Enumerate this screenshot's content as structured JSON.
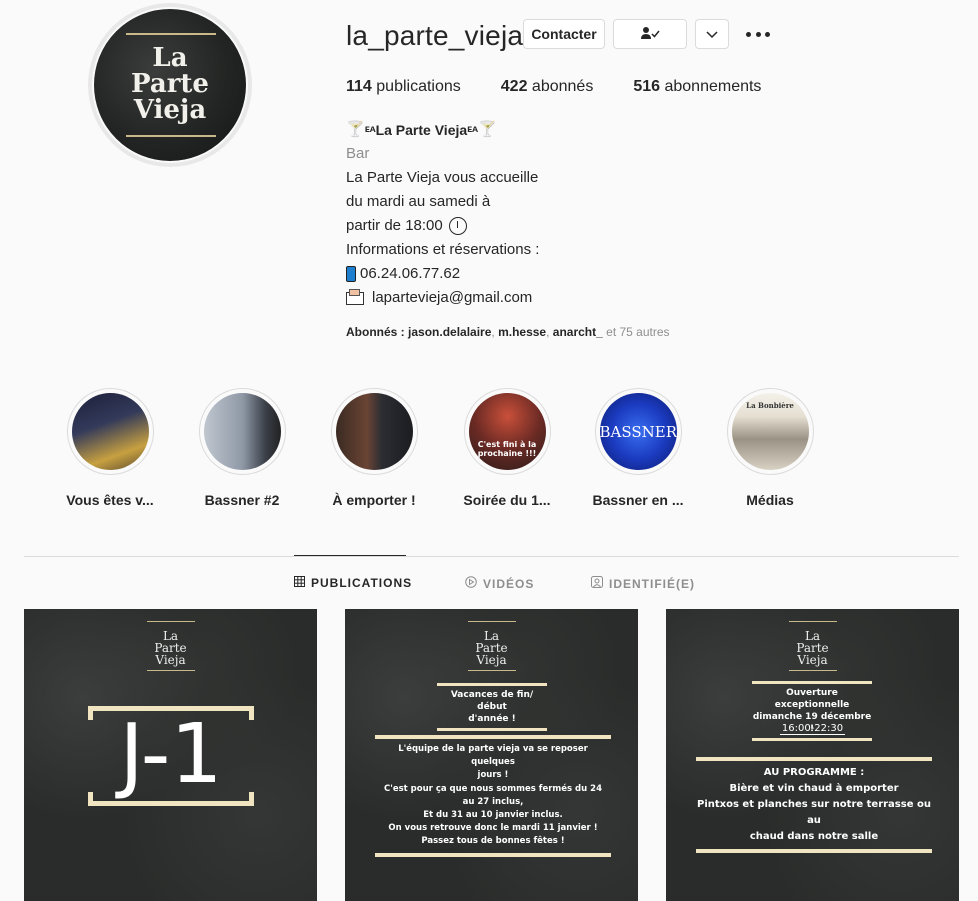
{
  "profile": {
    "avatar_text": [
      "La",
      "Parte",
      "Vieja"
    ],
    "username": "la_parte_vieja",
    "contact_label": "Contacter",
    "follow_icon": "person-check-icon",
    "chevron_icon": "chevron-down-icon",
    "more_icon": "ellipsis-icon"
  },
  "stats": [
    {
      "value": "114",
      "label": "publications"
    },
    {
      "value": "422",
      "label": "abonnés"
    },
    {
      "value": "516",
      "label": "abonnements"
    }
  ],
  "bio": {
    "name_prefix": "🍸",
    "name_tag_left": "ᴇᴀ",
    "name": "La Parte Vieja",
    "name_tag_right": "ᴇᴀ",
    "name_suffix": "🍸",
    "category": "Bar",
    "lines": [
      "La Parte Vieja vous accueille",
      "du mardi au samedi à",
      "partir de 18:00",
      "Informations et réservations :",
      "06.24.06.77.62",
      "lapartevieja@gmail.com"
    ],
    "followers_prefix": "Abonnés :",
    "followers_names": [
      "jason.delalaire",
      "m.hesse",
      "anarcht_"
    ],
    "followers_suffix": "et 75 autres"
  },
  "highlights": [
    {
      "label": "Vous êtes v..."
    },
    {
      "label": "Bassner #2"
    },
    {
      "label": "À emporter !"
    },
    {
      "label": "Soirée du 1...",
      "overlay": "C'est fini à la prochaine !!!"
    },
    {
      "label": "Bassner en ...",
      "overlay": "BASSNER"
    },
    {
      "label": "Médias",
      "overlay": "La Bonbière"
    }
  ],
  "tabs": [
    {
      "label": "PUBLICATIONS",
      "icon": "grid-icon",
      "active": true
    },
    {
      "label": "VIDÉOS",
      "icon": "play-circle-icon",
      "active": false
    },
    {
      "label": "IDENTIFIÉ(E)",
      "icon": "tag-person-icon",
      "active": false
    }
  ],
  "posts": [
    {
      "logo": [
        "La",
        "Parte",
        "Vieja"
      ],
      "big_text": "J-1"
    },
    {
      "logo": [
        "La",
        "Parte",
        "Vieja"
      ],
      "box1": [
        "Vacances de fin/ début",
        "d'année !"
      ],
      "box2": [
        "L'équipe de la parte vieja va se reposer quelques",
        "jours !",
        "C'est pour ça que nous sommes fermés du 24",
        "au 27 inclus,",
        "Et du 31 au 10 janvier inclus.",
        "On vous retrouve donc le mardi 11 janvier !",
        "Passez tous de bonnes fêtes !"
      ]
    },
    {
      "logo": [
        "La",
        "Parte",
        "Vieja"
      ],
      "box1": [
        "Ouverture exceptionnelle",
        "dimanche 19 décembre !"
      ],
      "hours": "16:00-22:30",
      "box2_title": "AU PROGRAMME :",
      "box2": [
        "Bière et vin chaud à emporter",
        "Pintxos et planches sur notre terrasse ou au",
        "chaud dans notre salle"
      ]
    }
  ]
}
